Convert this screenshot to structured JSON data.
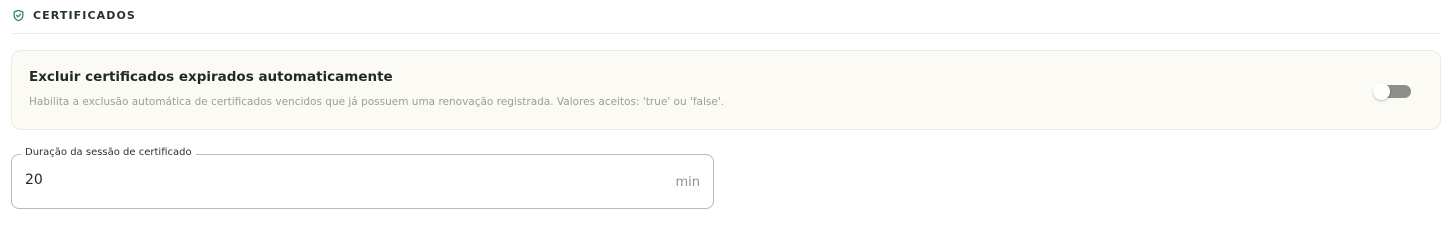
{
  "section": {
    "icon": "shield-check-icon",
    "title": "CERTIFICADOS",
    "accent_color": "#2e8b57"
  },
  "auto_delete_setting": {
    "title": "Excluir certificados expirados automaticamente",
    "description": "Habilita a exclusão automática de certificados vencidos que já possuem uma renovação registrada. Valores aceitos: 'true' ou 'false'.",
    "enabled": false
  },
  "session_duration": {
    "label": "Duração da sessão de certificado",
    "value": "20",
    "unit": "min"
  }
}
